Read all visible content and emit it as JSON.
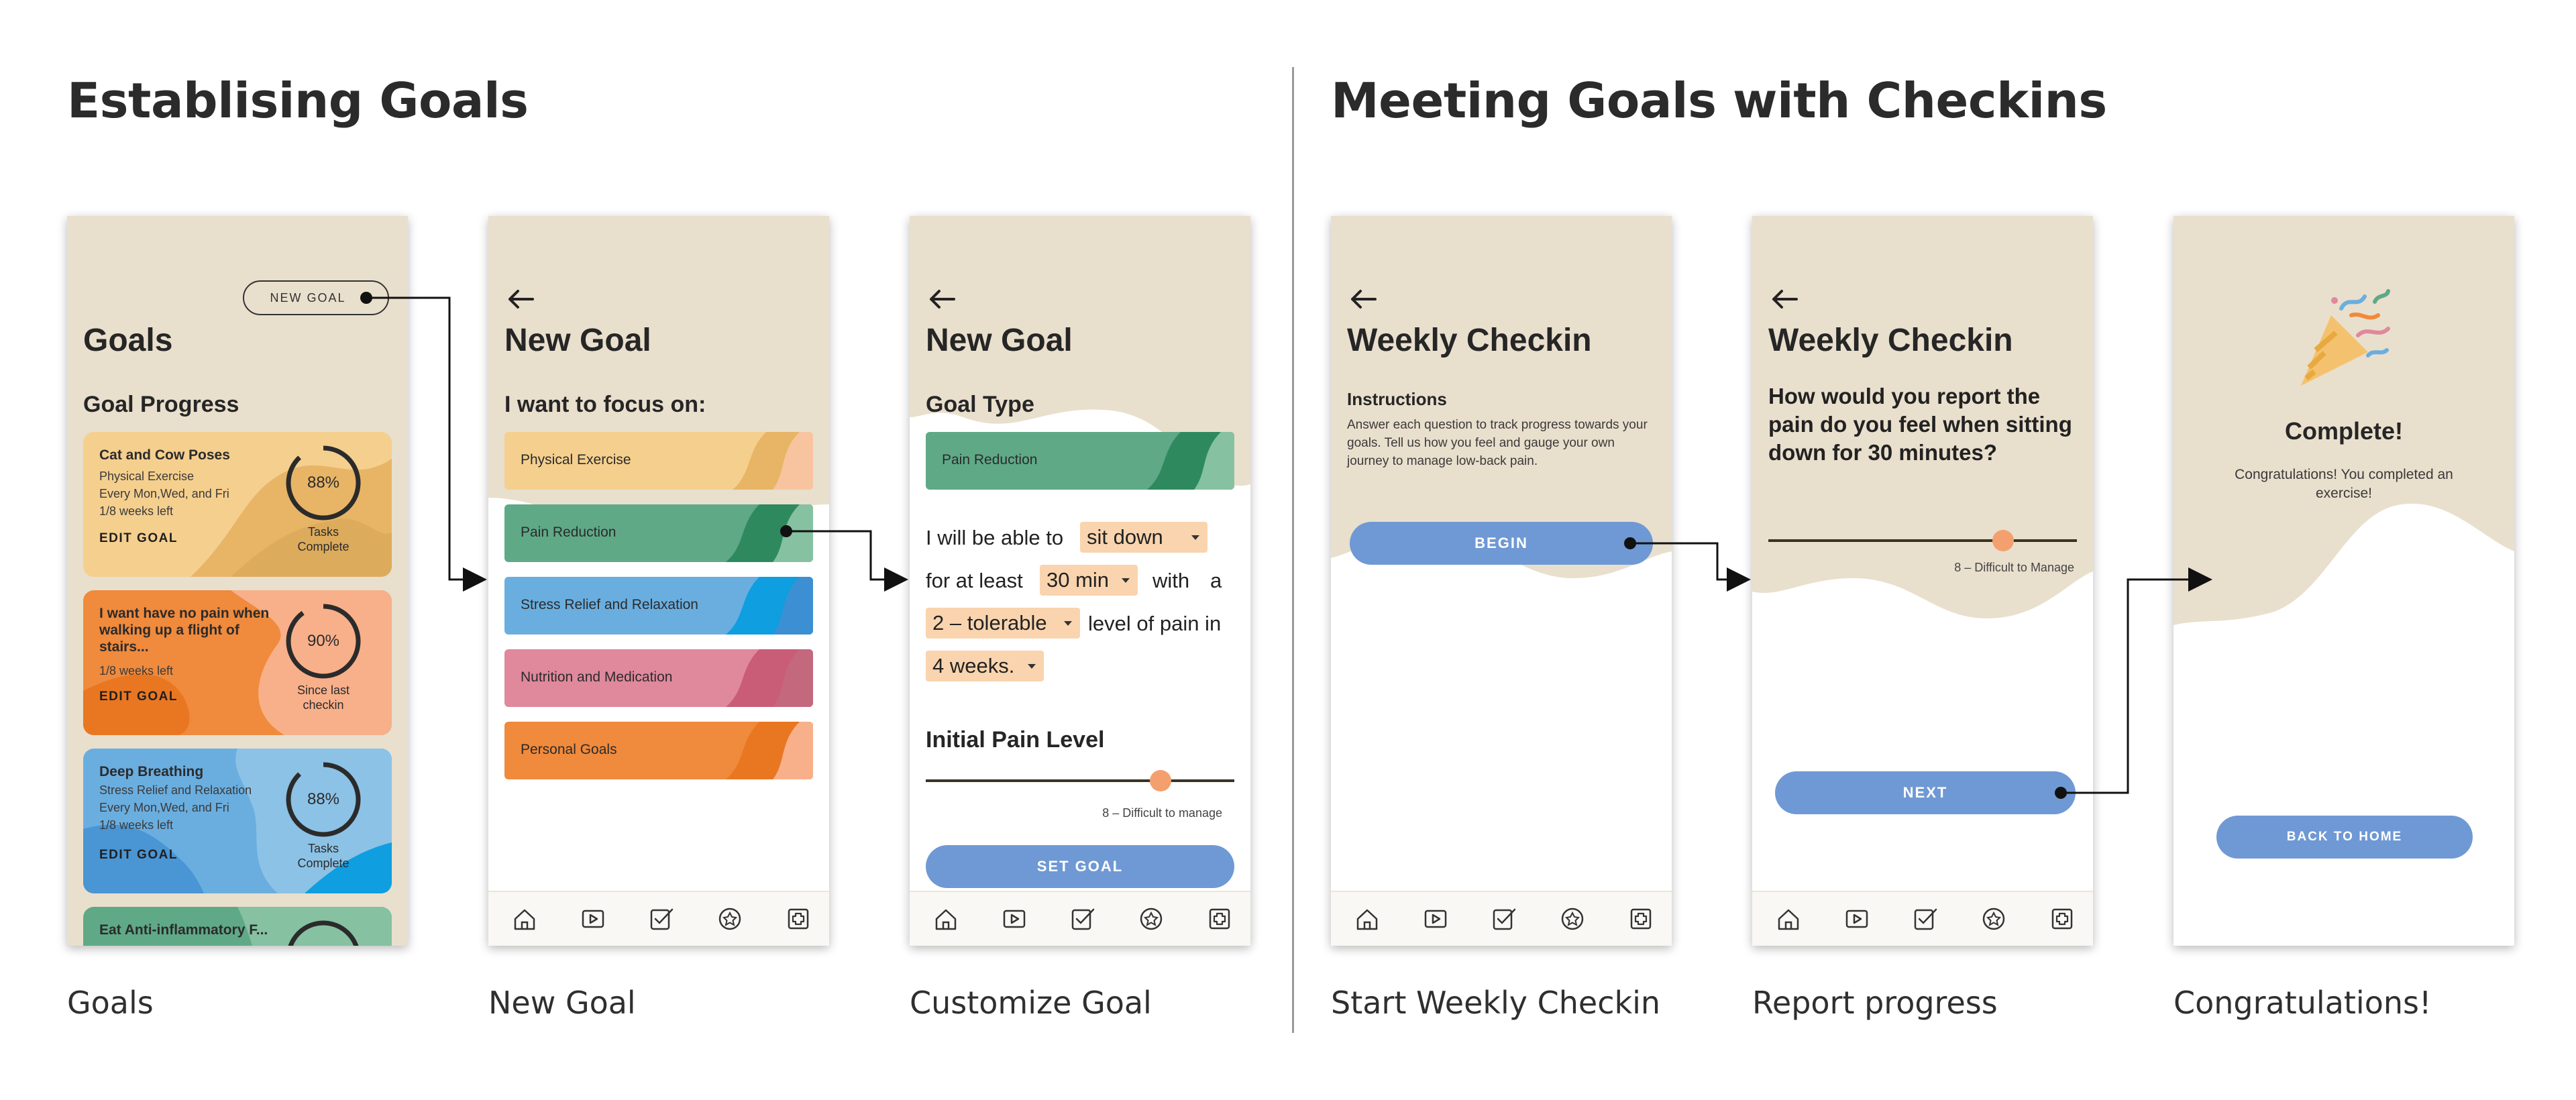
{
  "sections": {
    "left_title": "Establising Goals",
    "right_title": "Meeting Goals with Checkins"
  },
  "captions": [
    "Goals",
    "New Goal",
    "Customize Goal",
    "Start Weekly Checkin",
    "Report progress",
    "Congratulations!"
  ],
  "colors": {
    "beige": "#e9dfcd",
    "blue_button": "#6f99d4",
    "accent_orange": "#f4a06e",
    "select_fill": "#f9d4ae"
  },
  "nav_icons": [
    "home-icon",
    "video-icon",
    "checklist-icon",
    "star-icon",
    "medical-plus-icon"
  ],
  "goals_screen": {
    "new_goal_button": "NEW GOAL",
    "title": "Goals",
    "subtitle": "Goal Progress",
    "cards": [
      {
        "title": "Cat and Cow Poses",
        "details": [
          "Physical Exercise",
          "Every Mon,Wed, and Fri",
          "1/8 weeks left"
        ],
        "edit": "EDIT GOAL",
        "percent": "88%",
        "progress": 0.88,
        "ring_label": [
          "Tasks",
          "Complete"
        ],
        "color": "#f5cf8e"
      },
      {
        "title": "I want have no pain when walking up a flight of stairs...",
        "details": [
          "1/8 weeks left"
        ],
        "edit": "EDIT GOAL",
        "percent": "90%",
        "progress": 0.9,
        "ring_label": [
          "Since last",
          "checkin"
        ],
        "color": "#f08a3c"
      },
      {
        "title": "Deep Breathing",
        "details": [
          "Stress Relief and Relaxation",
          "Every Mon,Wed, and Fri",
          "1/8 weeks left"
        ],
        "edit": "EDIT GOAL",
        "percent": "88%",
        "progress": 0.88,
        "ring_label": [
          "Tasks",
          "Complete"
        ],
        "color": "#6aaee0"
      },
      {
        "title": "Eat Anti-inflammatory F...",
        "color": "#5fa987"
      }
    ]
  },
  "new_goal_screen": {
    "title": "New Goal",
    "prompt": "I want to focus on:",
    "categories": [
      {
        "label": "Physical Exercise",
        "color": "#f5cf8e"
      },
      {
        "label": "Pain Reduction",
        "color": "#5fa987"
      },
      {
        "label": "Stress Relief and Relaxation",
        "color": "#6aaee0"
      },
      {
        "label": "Nutrition and Medication",
        "color": "#e0889c"
      },
      {
        "label": "Personal Goals",
        "color": "#f08a3c"
      }
    ]
  },
  "customize_screen": {
    "title": "New Goal",
    "goal_type_label": "Goal Type",
    "goal_type_value": "Pain Reduction",
    "sentence": {
      "part1": "I will be able to",
      "activity": "sit down",
      "part2": "for at least",
      "duration": "30 min",
      "part3": "with",
      "part4": "a",
      "pain_level": "2 – tolerable",
      "part5": "level of pain in",
      "weeks": "4 weeks."
    },
    "initial_pain_label": "Initial Pain Level",
    "slider_value": 0.76,
    "slider_caption": "8 – Difficult to manage",
    "set_goal": "SET GOAL"
  },
  "start_checkin_screen": {
    "title": "Weekly Checkin",
    "instructions_label": "Instructions",
    "instructions_text": "Answer each question to track progress towards your goals. Tell us how you feel and gauge your own journey to manage low-back pain.",
    "begin": "BEGIN"
  },
  "report_screen": {
    "title": "Weekly Checkin",
    "question": "How would you report the pain do you feel when sitting down for 30 minutes?",
    "slider_value": 0.76,
    "slider_caption": "8 – Difficult to Manage",
    "next": "NEXT"
  },
  "congrats_screen": {
    "heading": "Complete!",
    "message": "Congratulations! You completed an exercise!",
    "back_home": "BACK TO HOME"
  }
}
